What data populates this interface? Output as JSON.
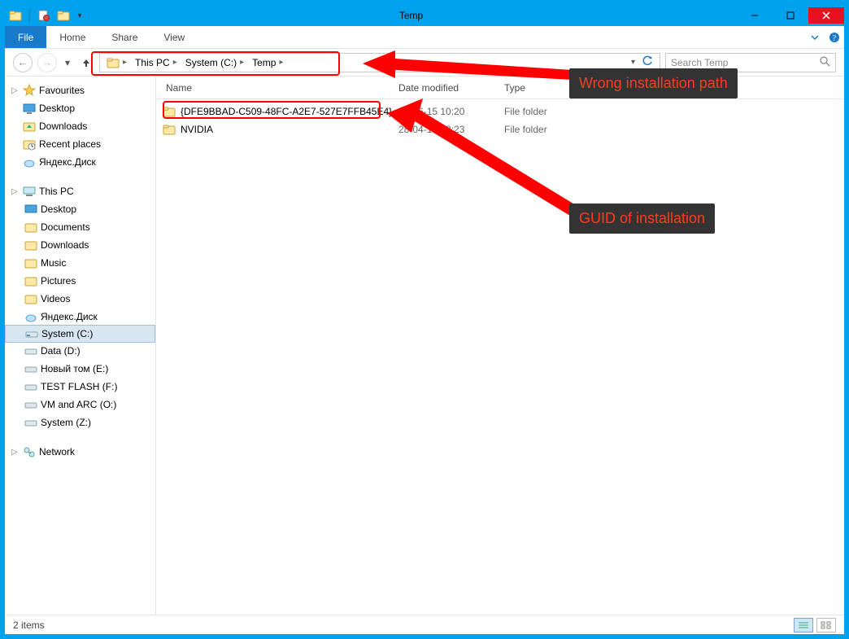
{
  "titlebar": {
    "title": "Temp"
  },
  "ribbon": {
    "file": "File",
    "tabs": [
      "Home",
      "Share",
      "View"
    ]
  },
  "breadcrumb": {
    "items": [
      "This PC",
      "System (C:)",
      "Temp"
    ]
  },
  "search": {
    "placeholder": "Search Temp"
  },
  "sidebar": {
    "favourites": {
      "label": "Favourites",
      "items": [
        "Desktop",
        "Downloads",
        "Recent places",
        "Яндекс.Диск"
      ]
    },
    "thispc": {
      "label": "This PC",
      "items": [
        "Desktop",
        "Documents",
        "Downloads",
        "Music",
        "Pictures",
        "Videos",
        "Яндекс.Диск",
        "System (C:)",
        "Data (D:)",
        "Новый том (E:)",
        "TEST FLASH (F:)",
        "VM and ARC (O:)",
        "System (Z:)"
      ]
    },
    "network": {
      "label": "Network"
    }
  },
  "columns": {
    "name": "Name",
    "date": "Date modified",
    "type": "Type"
  },
  "files": [
    {
      "name": "{DFE9BBAD-C509-48FC-A2E7-527E7FFB45E4}",
      "date": "02-06-15 10:20",
      "type": "File folder"
    },
    {
      "name": "NVIDIA",
      "date": "28-04-15 13:23",
      "type": "File folder"
    }
  ],
  "status": {
    "text": "2 items"
  },
  "annotations": {
    "path": "Wrong installation path",
    "guid": "GUID of installation"
  }
}
